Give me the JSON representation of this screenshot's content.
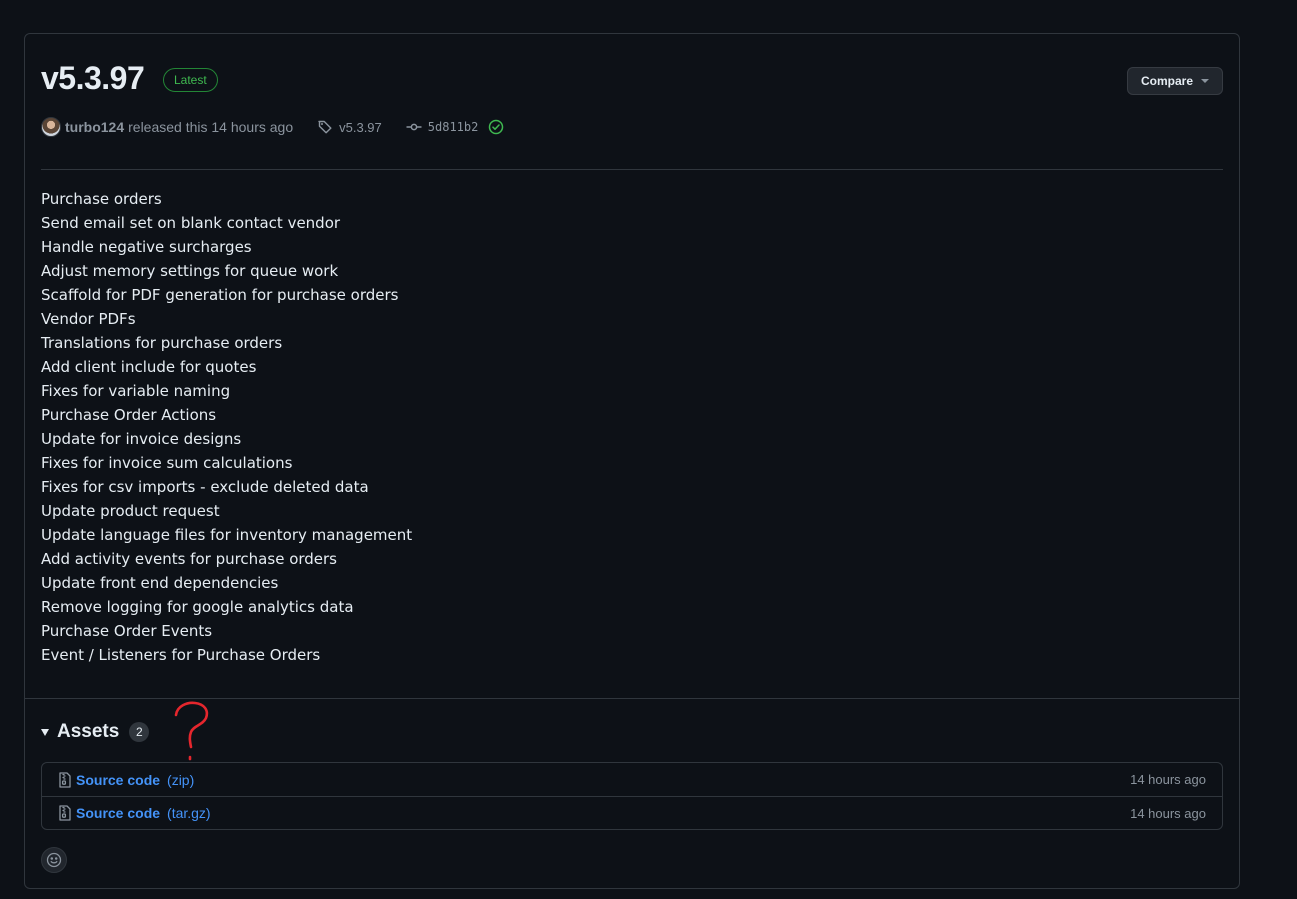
{
  "release": {
    "title": "v5.3.97",
    "badge": "Latest",
    "compare_label": "Compare",
    "author": "turbo124",
    "released_text": "released this 14 hours ago",
    "tag": "v5.3.97",
    "commit": "5d811b2"
  },
  "notes": [
    "Purchase orders",
    "Send email set on blank contact vendor",
    "Handle negative surcharges",
    "Adjust memory settings for queue work",
    "Scaffold for PDF generation for purchase orders",
    "Vendor PDFs",
    "Translations for purchase orders",
    "Add client include for quotes",
    "Fixes for variable naming",
    "Purchase Order Actions",
    "Update for invoice designs",
    "Fixes for invoice sum calculations",
    "Fixes for csv imports - exclude deleted data",
    "Update product request",
    "Update language files for inventory management",
    "Add activity events for purchase orders",
    "Update front end dependencies",
    "Remove logging for google analytics data",
    "Purchase Order Events",
    "Event / Listeners for Purchase Orders"
  ],
  "assets": {
    "title": "Assets",
    "count": "2",
    "items": [
      {
        "name": "Source code",
        "ext": "(zip)",
        "time": "14 hours ago"
      },
      {
        "name": "Source code",
        "ext": "(tar.gz)",
        "time": "14 hours ago"
      }
    ]
  },
  "icons": {
    "tag": "tag-icon",
    "commit": "git-commit-icon",
    "verified": "check-circle-icon",
    "archive": "file-zip-icon",
    "reaction": "smiley-icon",
    "annotation": "question-mark-annotation"
  },
  "colors": {
    "background": "#0d1117",
    "border": "#30363d",
    "text": "#e6edf3",
    "muted": "#8b949e",
    "link": "#4493f8",
    "success": "#3fb950",
    "annotation": "#e5262d"
  }
}
